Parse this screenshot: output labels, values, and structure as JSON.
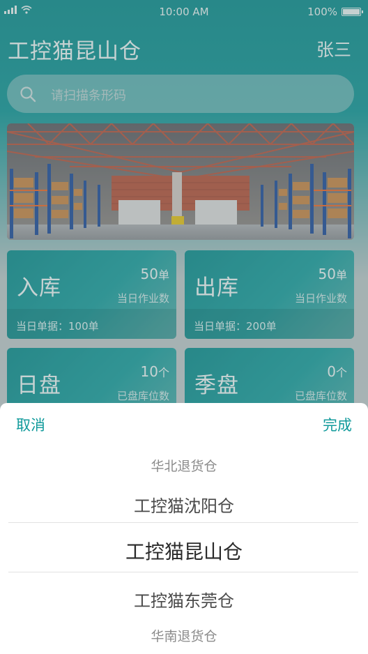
{
  "status_bar": {
    "time": "10:00 AM",
    "battery": "100%"
  },
  "header": {
    "title": "工控猫昆山仓",
    "user": "张三"
  },
  "search": {
    "placeholder": "请扫描条形码"
  },
  "cards": [
    {
      "title": "入库",
      "count": "50",
      "unit": "单",
      "sub": "当日作业数",
      "footer": "当日单据：100单"
    },
    {
      "title": "出库",
      "count": "50",
      "unit": "单",
      "sub": "当日作业数",
      "footer": "当日单据：200单"
    },
    {
      "title": "日盘",
      "count": "10",
      "unit": "个",
      "sub": "已盘库位数"
    },
    {
      "title": "季盘",
      "count": "0",
      "unit": "个",
      "sub": "已盘库位数"
    }
  ],
  "picker": {
    "cancel_label": "取消",
    "done_label": "完成",
    "options": [
      "华北退货仓",
      "工控猫沈阳仓",
      "工控猫昆山仓",
      "工控猫东莞仓",
      "华南退货仓"
    ],
    "selected": "工控猫昆山仓"
  },
  "colors": {
    "accent": "#109a9b",
    "header_bg": "#0d8f90"
  }
}
